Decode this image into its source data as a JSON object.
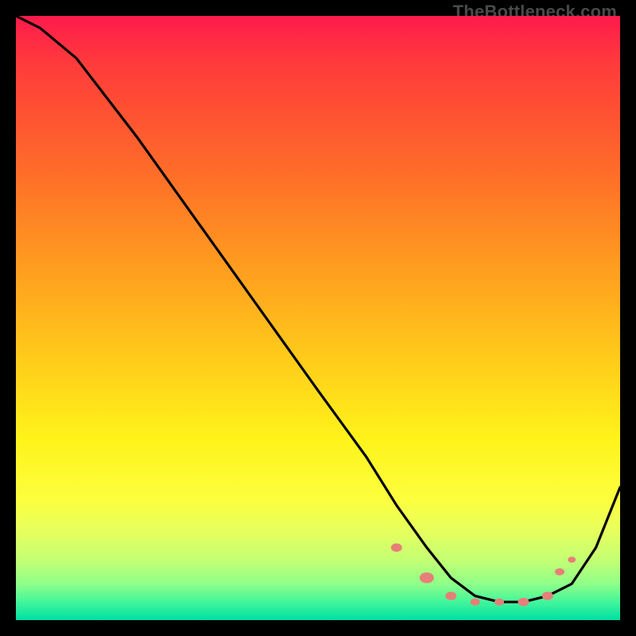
{
  "watermark": "TheBottleneck.com",
  "chart_data": {
    "type": "line",
    "title": "",
    "xlabel": "",
    "ylabel": "",
    "xlim": [
      0,
      100
    ],
    "ylim": [
      0,
      100
    ],
    "grid": false,
    "legend": false,
    "series": [
      {
        "name": "bottleneck-curve",
        "color": "#000000",
        "x": [
          0,
          4,
          10,
          20,
          30,
          40,
          50,
          58,
          63,
          68,
          72,
          76,
          80,
          84,
          88,
          92,
          96,
          100
        ],
        "y": [
          100,
          98,
          93,
          80,
          66,
          52,
          38,
          27,
          19,
          12,
          7,
          4,
          3,
          3,
          4,
          6,
          12,
          22
        ]
      }
    ],
    "markers": [
      {
        "x": 63,
        "y": 12,
        "color": "#e77f78",
        "r": 7
      },
      {
        "x": 68,
        "y": 7,
        "color": "#e77f78",
        "r": 9
      },
      {
        "x": 72,
        "y": 4,
        "color": "#e77f78",
        "r": 7
      },
      {
        "x": 76,
        "y": 3,
        "color": "#e77f78",
        "r": 6
      },
      {
        "x": 80,
        "y": 3,
        "color": "#e77f78",
        "r": 6
      },
      {
        "x": 84,
        "y": 3,
        "color": "#e77f78",
        "r": 7
      },
      {
        "x": 88,
        "y": 4,
        "color": "#e77f78",
        "r": 7
      },
      {
        "x": 90,
        "y": 8,
        "color": "#e77f78",
        "r": 6
      },
      {
        "x": 92,
        "y": 10,
        "color": "#e77f78",
        "r": 5
      }
    ],
    "gradient_colors": {
      "top": "#ff1a4d",
      "mid": "#fff31a",
      "bottom": "#00e0a4"
    }
  }
}
